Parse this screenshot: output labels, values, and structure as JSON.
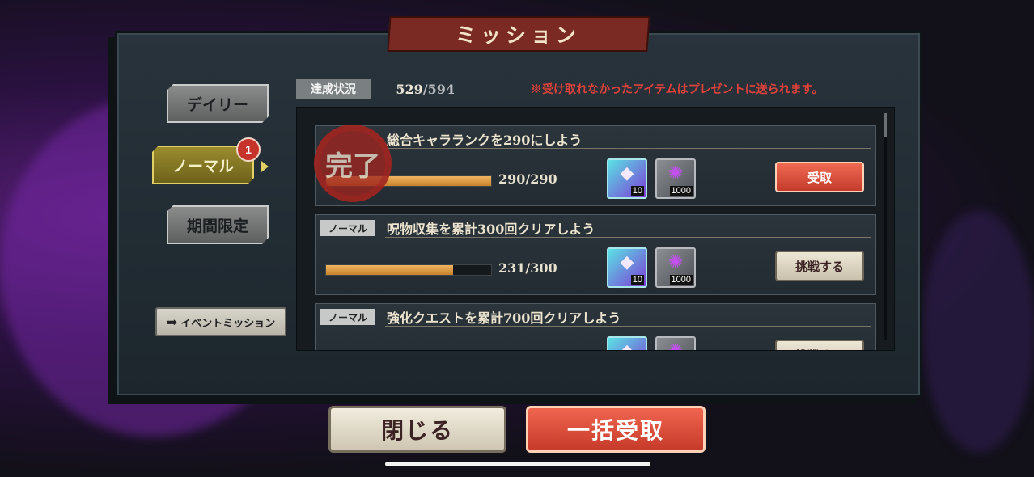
{
  "title": "ミッション",
  "tabs": [
    {
      "label": "デイリー"
    },
    {
      "label": "ノーマル",
      "badge": "1"
    },
    {
      "label": "期間限定"
    }
  ],
  "event_button": {
    "arrow_icon": "arrow-right-icon",
    "label": "イベントミッション"
  },
  "status": {
    "label": "達成状況",
    "current": "529",
    "max": "/594"
  },
  "notice": "※受け取れなかったアイテムはプレゼントに送られます。",
  "stamp_text": "完了",
  "missions": [
    {
      "title": "総合キャラランクを290にしよう",
      "progress_text": "290/290",
      "progress_fraction": 1.0,
      "rewards": [
        {
          "icon": "cube-icon",
          "qty": "10"
        },
        {
          "icon": "curse-icon",
          "qty": "1000"
        }
      ],
      "action_label": "受取"
    },
    {
      "category": "ノーマル",
      "title": "呪物収集を累計300回クリアしよう",
      "progress_text": "231/300",
      "progress_fraction": 0.77,
      "rewards": [
        {
          "icon": "cube-icon",
          "qty": "10"
        },
        {
          "icon": "curse-icon",
          "qty": "1000"
        }
      ],
      "action_label": "挑戦する"
    },
    {
      "category": "ノーマル",
      "title": "強化クエストを累計700回クリアしよう",
      "rewards": [
        {
          "icon": "cube-icon"
        },
        {
          "icon": "curse-icon"
        }
      ],
      "action_label": "挑戦する"
    }
  ],
  "buttons": {
    "close": "閉じる",
    "collect_all": "一括受取"
  },
  "colors": {
    "accent_red": "#c63a2b",
    "active_tab": "#9b8c2e",
    "panel": "#28333b",
    "progress": "#e0a24a"
  }
}
